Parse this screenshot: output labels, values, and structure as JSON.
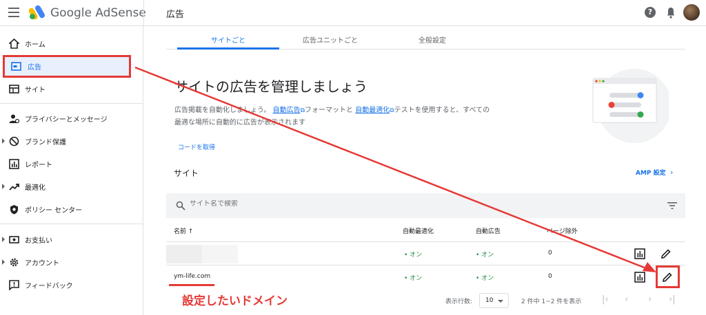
{
  "header": {
    "brand": "Google AdSense",
    "page_title": "広告",
    "help_glyph": "?"
  },
  "sidebar": {
    "items": [
      {
        "label": "ホーム",
        "icon": "home-icon"
      },
      {
        "label": "広告",
        "icon": "ads-icon",
        "active": true
      },
      {
        "label": "サイト",
        "icon": "sites-icon"
      },
      {
        "label": "プライバシーとメッセージ",
        "icon": "privacy-icon"
      },
      {
        "label": "ブランド保護",
        "icon": "block-icon"
      },
      {
        "label": "レポート",
        "icon": "report-icon"
      },
      {
        "label": "最適化",
        "icon": "optimize-icon"
      },
      {
        "label": "ポリシー センター",
        "icon": "policy-icon"
      },
      {
        "label": "お支払い",
        "icon": "payments-icon"
      },
      {
        "label": "アカウント",
        "icon": "settings-icon"
      },
      {
        "label": "フィードバック",
        "icon": "feedback-icon"
      }
    ]
  },
  "tabs": [
    {
      "label": "サイトごと",
      "active": true
    },
    {
      "label": "広告ユニットごと"
    },
    {
      "label": "全般設定"
    }
  ],
  "hero": {
    "title": "サイトの広告を管理しましょう",
    "desc_part1": "広告掲載を自動化しましょう。",
    "link_auto_ads": "自動広告",
    "desc_part2": "フォーマットと",
    "link_auto_opt": "自動最適化",
    "desc_part3": "テストを使用すると、すべての最適な場所に自動的に広告が表示されます",
    "get_code": "コードを取得"
  },
  "sites": {
    "section_title": "サイト",
    "amp_settings": "AMP 設定",
    "search_placeholder": "サイト名で検索",
    "columns": [
      "名前 ↑",
      "自動最適化",
      "自動広告",
      "ページ除外"
    ],
    "rows": [
      {
        "name": "",
        "auto_opt": "• オン",
        "auto_ads": "• オン",
        "excluded": "0"
      },
      {
        "name": "ym-life.com",
        "auto_opt": "• オン",
        "auto_ads": "• オン",
        "excluded": "0"
      }
    ]
  },
  "annotation": {
    "note": "設定したいドメイン",
    "color": "#e53935"
  },
  "pager": {
    "rows_label": "表示行数:",
    "rows_value": "10",
    "count": "2 件中 1~2 件を表示"
  },
  "colors": {
    "accent": "#1a73e8",
    "status_on": "#1e8e3e",
    "highlight": "#e53935"
  }
}
